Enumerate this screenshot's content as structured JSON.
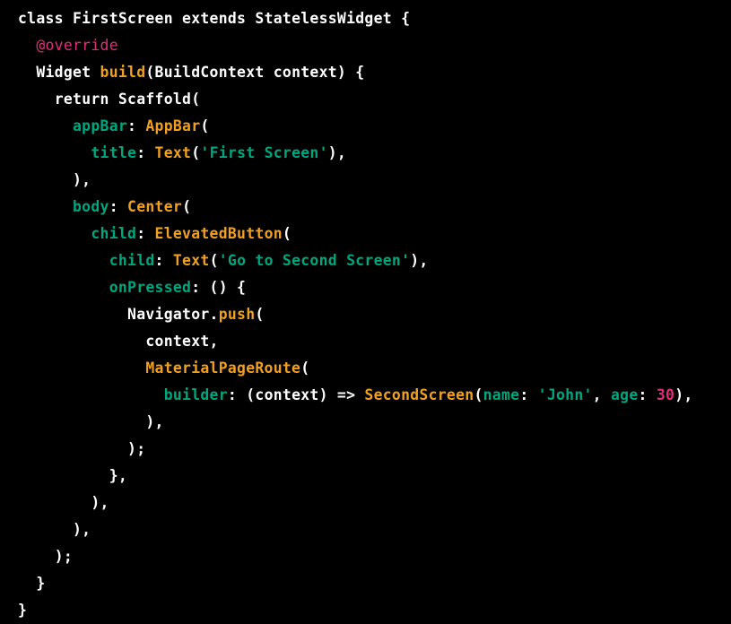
{
  "code_view": {
    "language": "dart",
    "colors": {
      "background": "#000000",
      "plain": "#ffffff",
      "type": "#f0a020",
      "param": "#00a67d",
      "string": "#00a67d",
      "annotation": "#df3079",
      "number": "#df3079"
    },
    "lines": [
      {
        "indent": 0,
        "tokens": [
          [
            "kw",
            "class "
          ],
          [
            "plain",
            "FirstScreen "
          ],
          [
            "kw",
            "extends "
          ],
          [
            "plain",
            "StatelessWidget {"
          ]
        ]
      },
      {
        "indent": 1,
        "tokens": [
          [
            "annot",
            "@override"
          ]
        ]
      },
      {
        "indent": 1,
        "tokens": [
          [
            "plain",
            "Widget "
          ],
          [
            "type",
            "build"
          ],
          [
            "plain",
            "(BuildContext context) {"
          ]
        ]
      },
      {
        "indent": 2,
        "tokens": [
          [
            "kw",
            "return "
          ],
          [
            "plain",
            "Scaffold("
          ]
        ]
      },
      {
        "indent": 3,
        "tokens": [
          [
            "param",
            "appBar"
          ],
          [
            "plain",
            ": "
          ],
          [
            "type",
            "AppBar"
          ],
          [
            "plain",
            "("
          ]
        ]
      },
      {
        "indent": 4,
        "tokens": [
          [
            "param",
            "title"
          ],
          [
            "plain",
            ": "
          ],
          [
            "type",
            "Text"
          ],
          [
            "plain",
            "("
          ],
          [
            "string",
            "'First Screen'"
          ],
          [
            "plain",
            "),"
          ]
        ]
      },
      {
        "indent": 3,
        "tokens": [
          [
            "plain",
            "),"
          ]
        ]
      },
      {
        "indent": 3,
        "tokens": [
          [
            "param",
            "body"
          ],
          [
            "plain",
            ": "
          ],
          [
            "type",
            "Center"
          ],
          [
            "plain",
            "("
          ]
        ]
      },
      {
        "indent": 4,
        "tokens": [
          [
            "param",
            "child"
          ],
          [
            "plain",
            ": "
          ],
          [
            "type",
            "ElevatedButton"
          ],
          [
            "plain",
            "("
          ]
        ]
      },
      {
        "indent": 5,
        "tokens": [
          [
            "param",
            "child"
          ],
          [
            "plain",
            ": "
          ],
          [
            "type",
            "Text"
          ],
          [
            "plain",
            "("
          ],
          [
            "string",
            "'Go to Second Screen'"
          ],
          [
            "plain",
            "),"
          ]
        ]
      },
      {
        "indent": 5,
        "tokens": [
          [
            "param",
            "onPressed"
          ],
          [
            "plain",
            ": () {"
          ]
        ]
      },
      {
        "indent": 6,
        "tokens": [
          [
            "plain",
            "Navigator."
          ],
          [
            "type",
            "push"
          ],
          [
            "plain",
            "("
          ]
        ]
      },
      {
        "indent": 7,
        "tokens": [
          [
            "plain",
            "context,"
          ]
        ]
      },
      {
        "indent": 7,
        "tokens": [
          [
            "type",
            "MaterialPageRoute"
          ],
          [
            "plain",
            "("
          ]
        ]
      },
      {
        "indent": 8,
        "tokens": [
          [
            "param",
            "builder"
          ],
          [
            "plain",
            ": (context) => "
          ],
          [
            "type",
            "SecondScreen"
          ],
          [
            "plain",
            "("
          ],
          [
            "param",
            "name"
          ],
          [
            "plain",
            ": "
          ],
          [
            "string",
            "'John'"
          ],
          [
            "plain",
            ", "
          ],
          [
            "param",
            "age"
          ],
          [
            "plain",
            ": "
          ],
          [
            "num",
            "30"
          ],
          [
            "plain",
            "),"
          ]
        ]
      },
      {
        "indent": 7,
        "tokens": [
          [
            "plain",
            "),"
          ]
        ]
      },
      {
        "indent": 6,
        "tokens": [
          [
            "plain",
            ");"
          ]
        ]
      },
      {
        "indent": 5,
        "tokens": [
          [
            "plain",
            "},"
          ]
        ]
      },
      {
        "indent": 4,
        "tokens": [
          [
            "plain",
            "),"
          ]
        ]
      },
      {
        "indent": 3,
        "tokens": [
          [
            "plain",
            "),"
          ]
        ]
      },
      {
        "indent": 2,
        "tokens": [
          [
            "plain",
            ");"
          ]
        ]
      },
      {
        "indent": 1,
        "tokens": [
          [
            "plain",
            "}"
          ]
        ]
      },
      {
        "indent": 0,
        "tokens": [
          [
            "plain",
            "}"
          ]
        ]
      }
    ]
  }
}
